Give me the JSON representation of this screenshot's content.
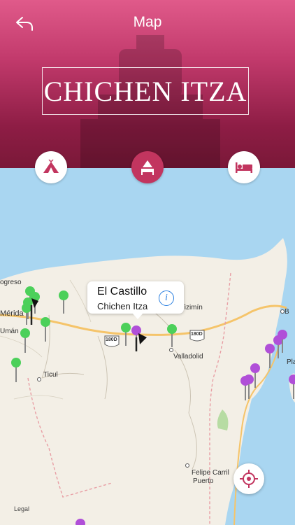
{
  "header": {
    "nav_title": "Map",
    "hero_title": "CHICHEN ITZA",
    "back_icon": "back-arrow-icon"
  },
  "category_buttons": [
    {
      "icon": "camping-tent-icon",
      "active": false
    },
    {
      "icon": "hotel-icon",
      "active": true
    },
    {
      "icon": "bed-icon",
      "active": false
    }
  ],
  "callout": {
    "title": "El Castillo",
    "subtitle": "Chichen Itza",
    "info_icon": "info-icon"
  },
  "map_labels": {
    "progreso": "ogreso",
    "merida": "Mérida",
    "uman": "Umán",
    "ticul": "Ticul",
    "valladolid": "Valladolid",
    "tizimin": "Tizimín",
    "felipe_carrillo": "Felipe Carril",
    "puerto": "Puerto",
    "playa": "Pla",
    "b": "B",
    "route_180d_a": "180D",
    "route_180d_b": "180D",
    "legal": "Legal"
  },
  "colors": {
    "accent": "#c2355f",
    "pin_green": "#4cd05a",
    "pin_purple": "#b04fd8",
    "water": "#a9d6f1",
    "land": "#f3efe6"
  },
  "locate_icon": "locate-crosshair-icon"
}
